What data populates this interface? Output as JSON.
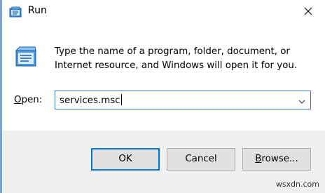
{
  "window": {
    "title": "Run",
    "accent_color": "#0078d7",
    "edge_color": "#7fa6c8"
  },
  "icons": {
    "app": "run-icon",
    "close": "close-icon",
    "dropdown": "chevron-down-icon"
  },
  "main": {
    "description_line1": "Type the name of a program, folder, document, or",
    "description_line2": "Internet resource, and Windows will open it for you.",
    "open_label_underlined": "O",
    "open_label_rest": "pen:",
    "open_value": "services.msc"
  },
  "buttons": {
    "ok": "OK",
    "cancel": "Cancel",
    "browse_underlined": "B",
    "browse_rest": "rowse..."
  },
  "watermark": "wsxdn.com"
}
